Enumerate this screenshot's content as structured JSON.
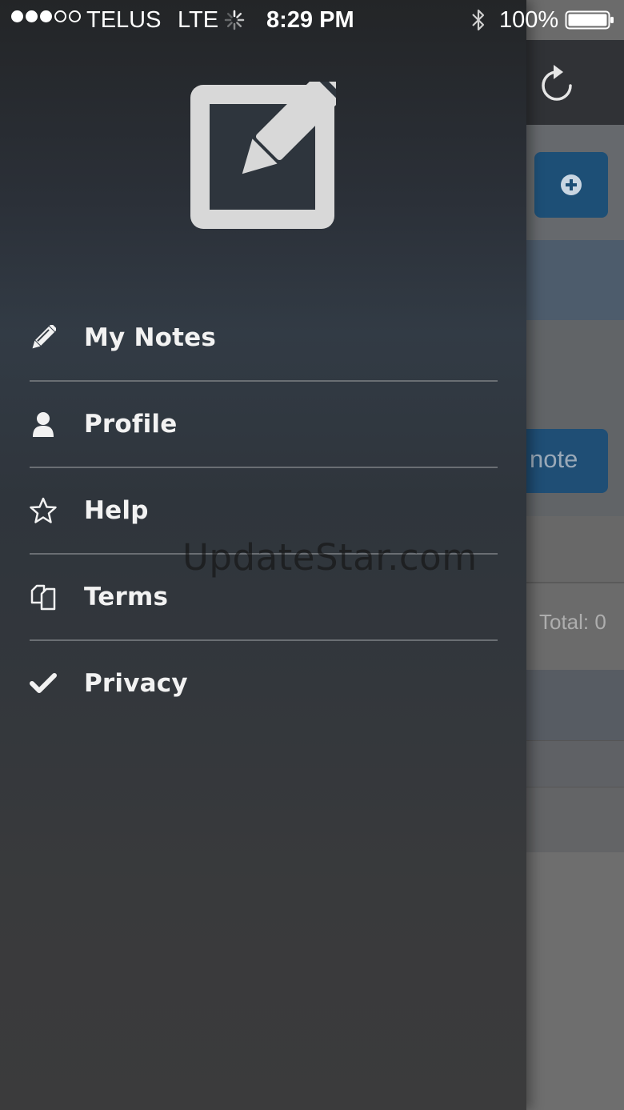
{
  "status_bar": {
    "signal_bars_filled": 3,
    "signal_bars_total": 5,
    "carrier": "TELUS",
    "network": "LTE",
    "time": "8:29 PM",
    "battery_percent": "100%",
    "icons": [
      "signal-icon",
      "activity-spinner-icon",
      "bluetooth-icon",
      "battery-icon"
    ]
  },
  "drawer": {
    "logo_icon": "edit-note-icon",
    "menu_items": [
      {
        "label": "My Notes",
        "icon": "pencil-icon"
      },
      {
        "label": "Profile",
        "icon": "user-icon"
      },
      {
        "label": "Help",
        "icon": "star-icon"
      },
      {
        "label": "Terms",
        "icon": "documents-icon"
      },
      {
        "label": "Privacy",
        "icon": "checkmark-icon"
      }
    ]
  },
  "background_app": {
    "refresh_icon": "refresh-icon",
    "add_button_icon": "plus-circle-icon",
    "note_button_label": "note",
    "total_label": "Total: 0"
  },
  "watermark": "UpdateStar.com",
  "colors": {
    "drawer_text": "#f2f2f2",
    "accent_button": "#1d4f76",
    "divider": "#6a6e73"
  }
}
